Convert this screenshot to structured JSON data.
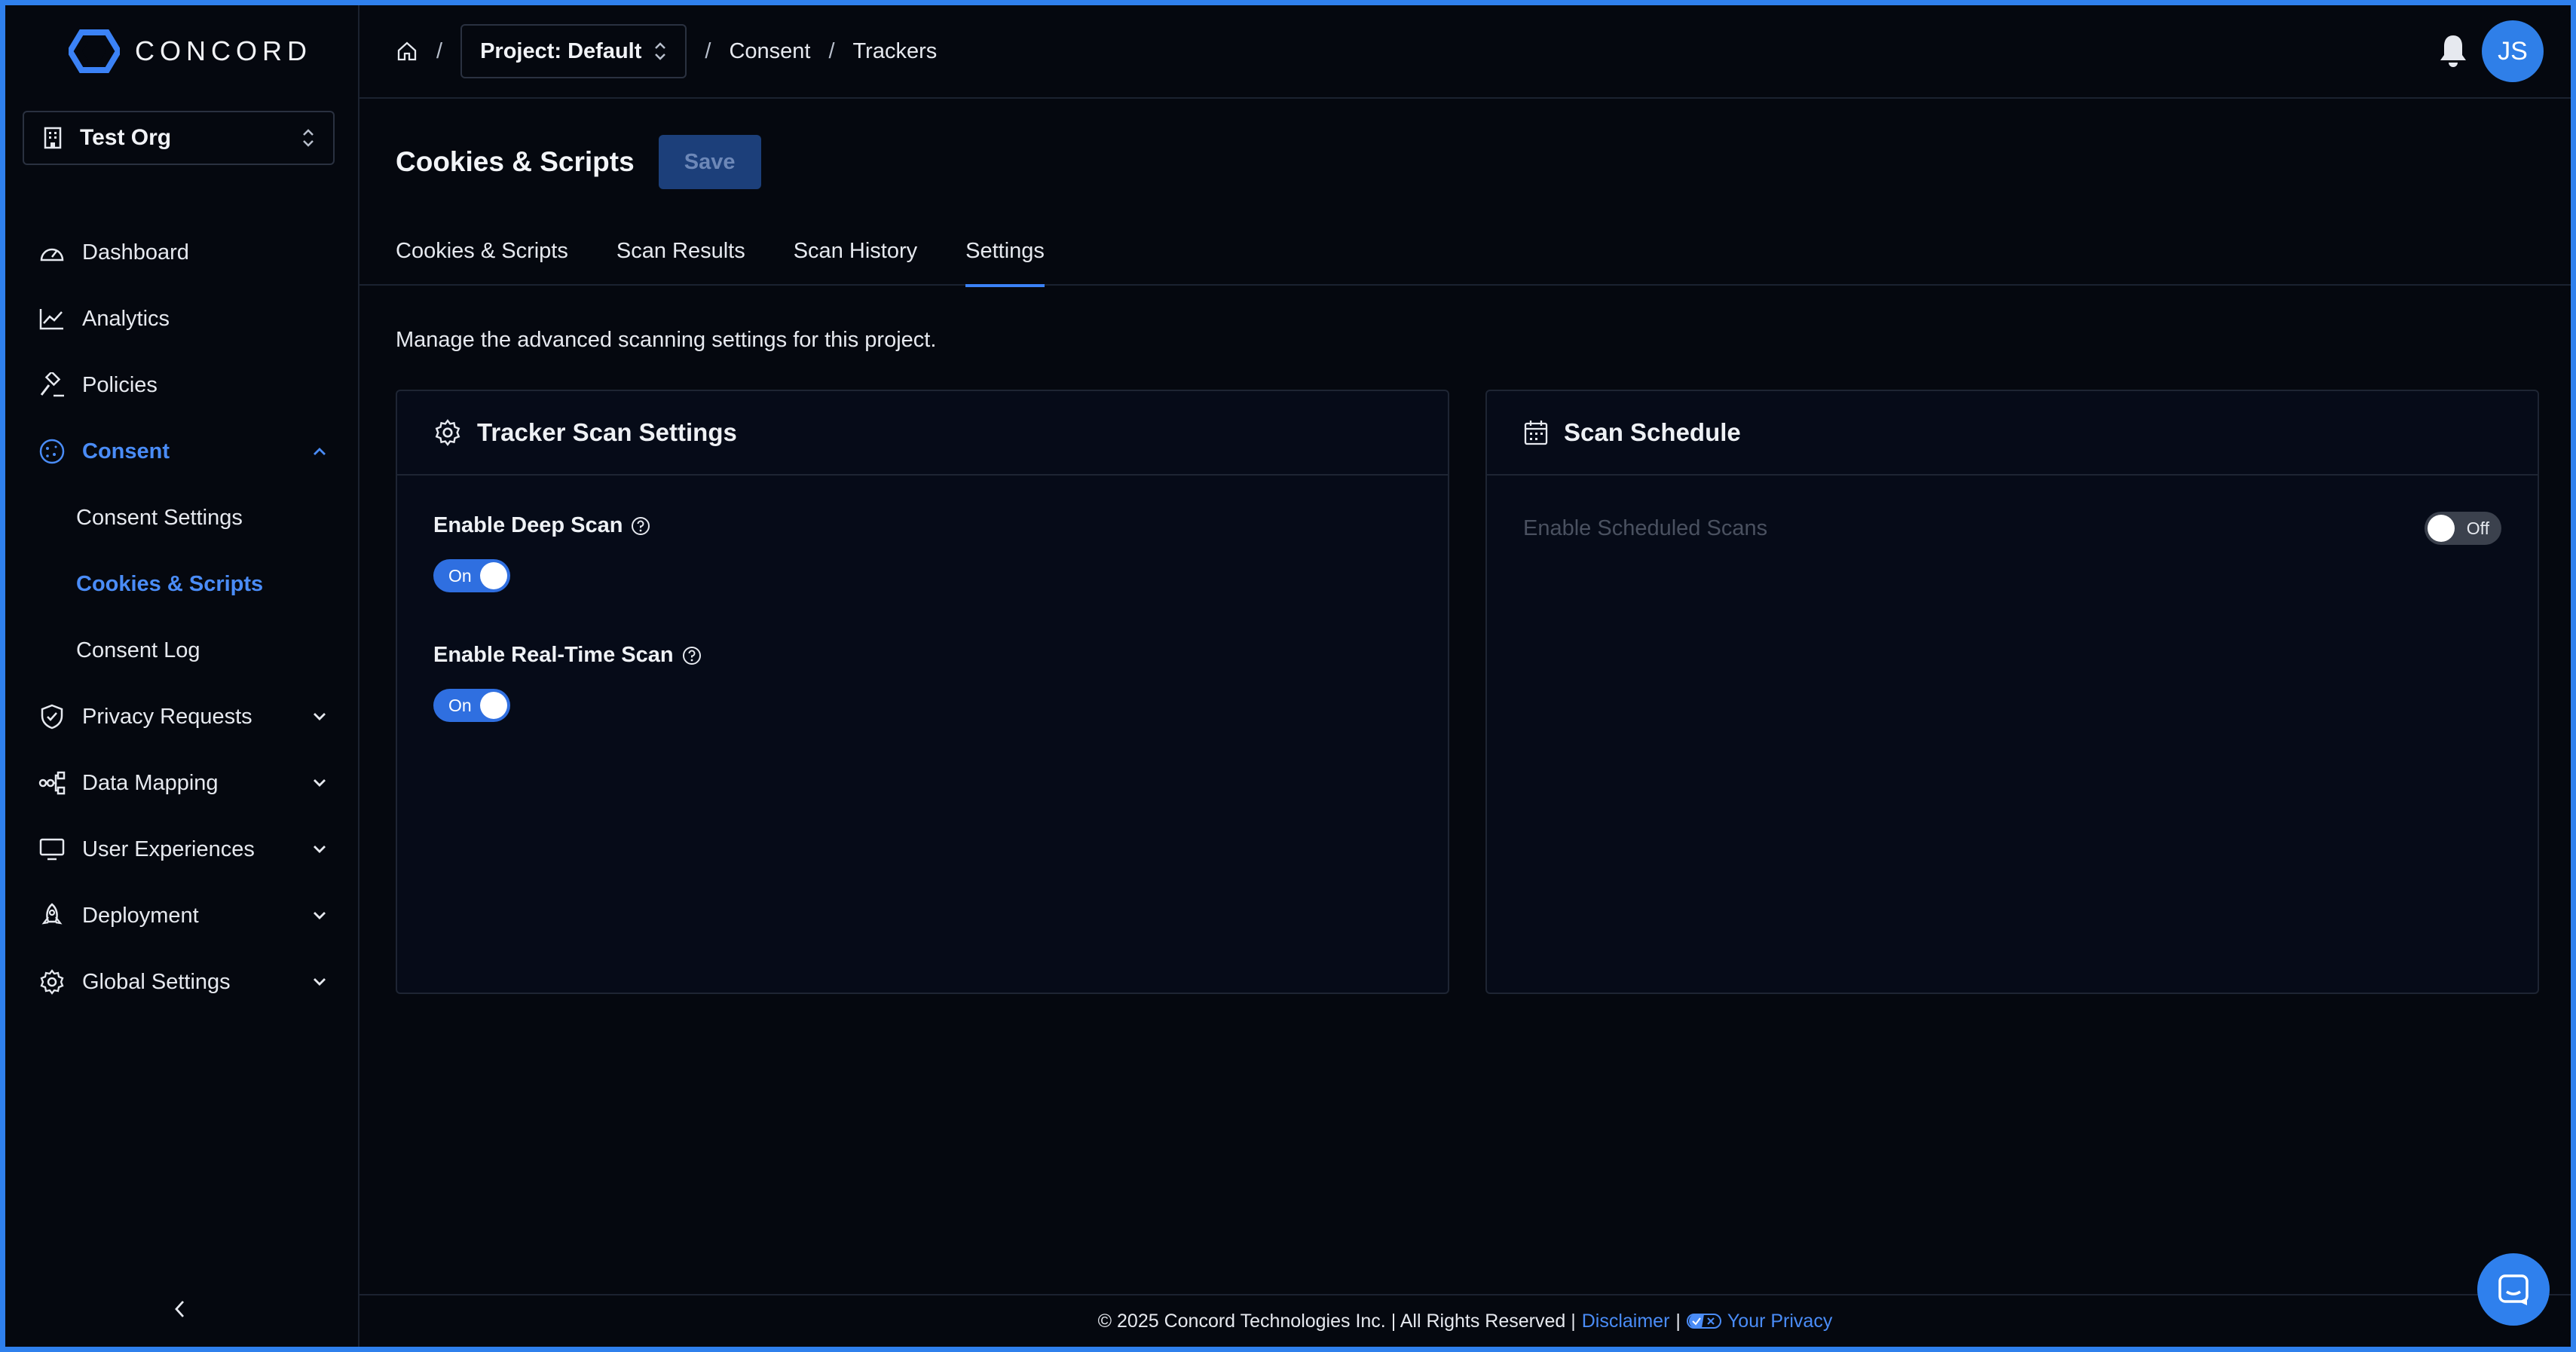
{
  "app": {
    "brand": "CONCORD",
    "accent": "#3b82f6"
  },
  "org": {
    "selected": "Test Org"
  },
  "sidebar": {
    "items": [
      {
        "label": "Dashboard",
        "icon": "gauge-icon"
      },
      {
        "label": "Analytics",
        "icon": "line-chart-icon"
      },
      {
        "label": "Policies",
        "icon": "gavel-icon"
      },
      {
        "label": "Consent",
        "icon": "cookie-icon",
        "expanded": true,
        "children": [
          {
            "label": "Consent Settings"
          },
          {
            "label": "Cookies & Scripts",
            "active": true
          },
          {
            "label": "Consent Log"
          }
        ]
      },
      {
        "label": "Privacy Requests",
        "icon": "shield-check-icon"
      },
      {
        "label": "Data Mapping",
        "icon": "network-icon"
      },
      {
        "label": "User Experiences",
        "icon": "monitor-icon"
      },
      {
        "label": "Deployment",
        "icon": "rocket-icon"
      },
      {
        "label": "Global Settings",
        "icon": "gear-icon"
      }
    ]
  },
  "topbar": {
    "breadcrumb": {
      "project": "Project: Default",
      "separator": "/",
      "items": [
        "Consent",
        "Trackers"
      ]
    },
    "user_initials": "JS"
  },
  "page": {
    "title": "Cookies & Scripts",
    "save_label": "Save",
    "tabs": [
      {
        "label": "Cookies & Scripts"
      },
      {
        "label": "Scan Results"
      },
      {
        "label": "Scan History"
      },
      {
        "label": "Settings",
        "active": true
      }
    ],
    "description": "Manage the advanced scanning settings for this project."
  },
  "tracker_card": {
    "title": "Tracker Scan Settings",
    "deep_scan": {
      "label": "Enable Deep Scan",
      "state": "On"
    },
    "realtime_scan": {
      "label": "Enable Real-Time Scan",
      "state": "On"
    }
  },
  "schedule_card": {
    "title": "Scan Schedule",
    "scheduled": {
      "label": "Enable Scheduled Scans",
      "state": "Off"
    }
  },
  "footer": {
    "copyright": "© 2025 Concord Technologies Inc. | All Rights Reserved |",
    "disclaimer": "Disclaimer",
    "privacy": "Your Privacy"
  }
}
